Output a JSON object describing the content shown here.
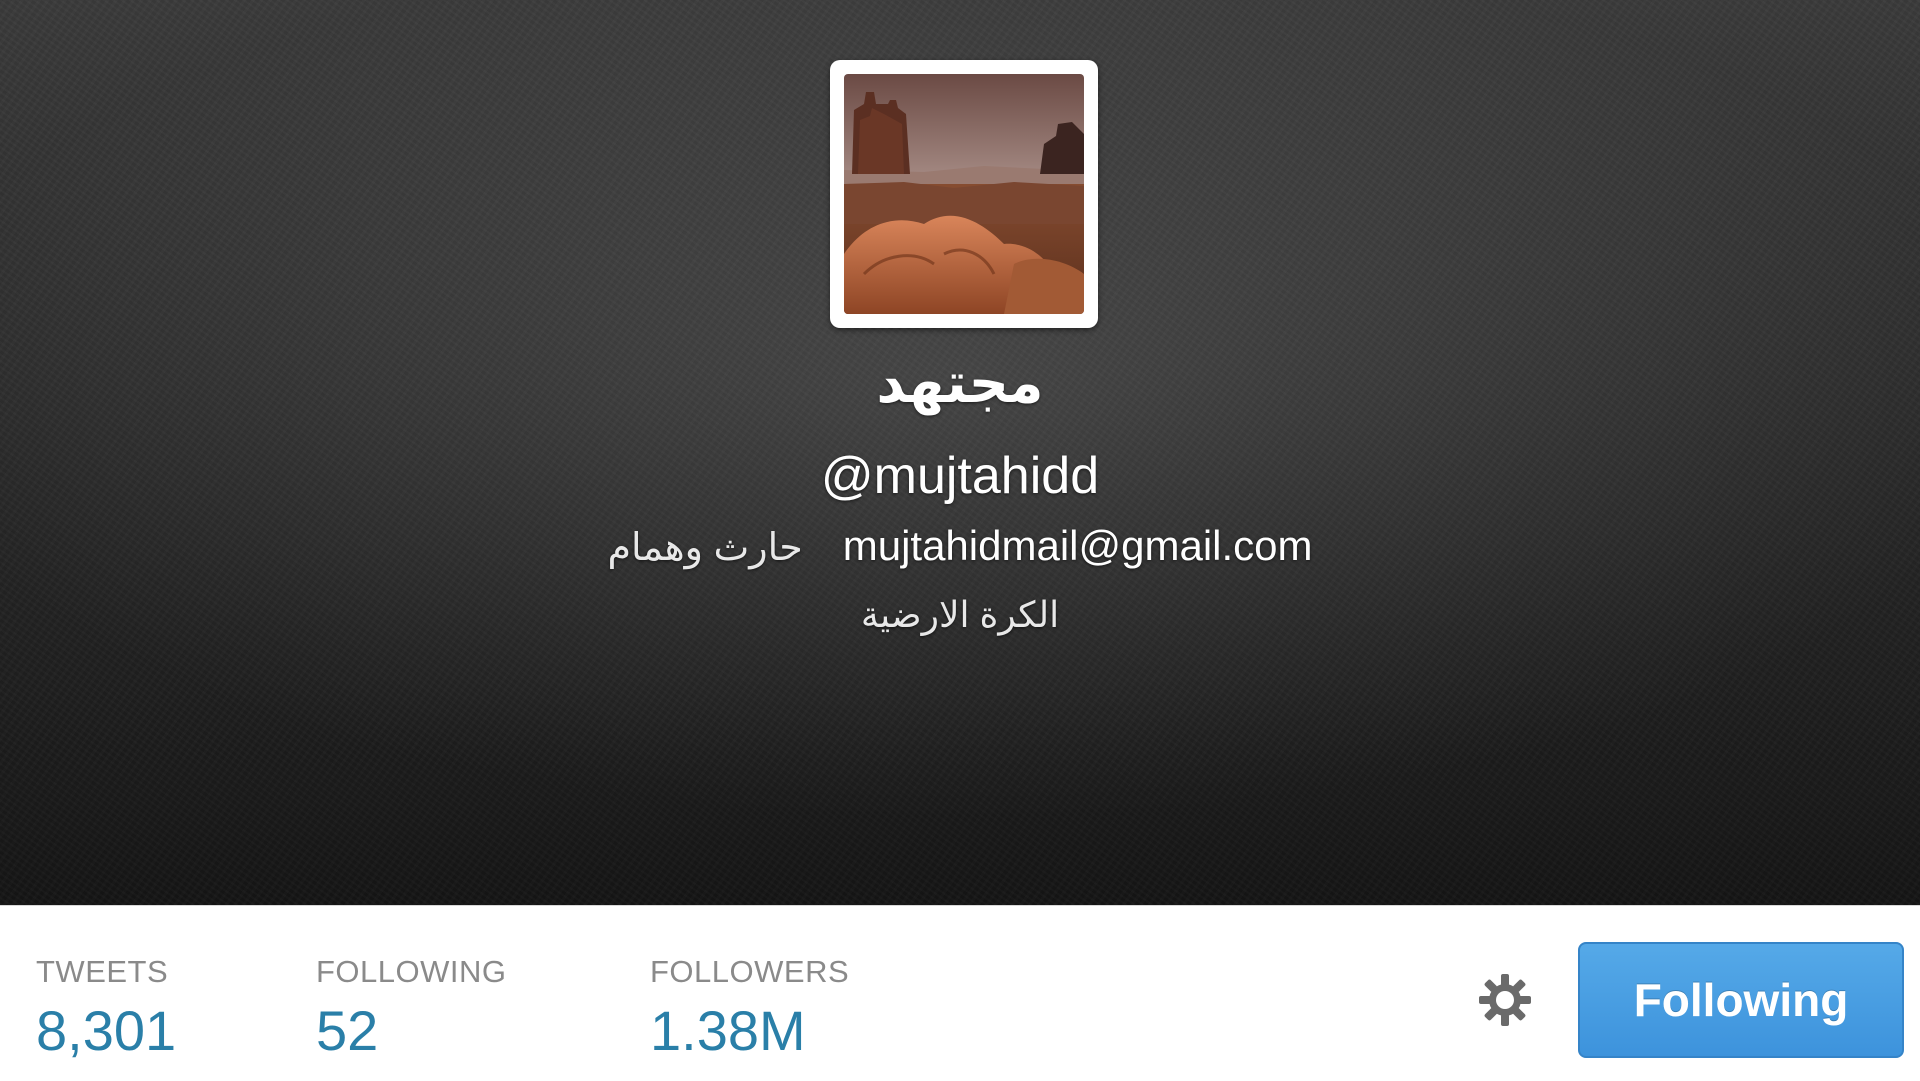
{
  "profile": {
    "name": "مجتهد",
    "screen_name": "@mujtahidd",
    "bio": "حارث وهمام",
    "email": "mujtahidmail@gmail.com",
    "location": "الكرة الارضية",
    "avatar": "desert-mesa-landscape-photo"
  },
  "stats": {
    "tweets": {
      "label": "TWEETS",
      "value": "8,301"
    },
    "following": {
      "label": "FOLLOWING",
      "value": "52"
    },
    "followers": {
      "label": "FOLLOWERS",
      "value": "1.38M"
    }
  },
  "actions": {
    "settings_icon": "gear-icon",
    "follow_button_label": "Following"
  },
  "colors": {
    "header_background": "#2c2c2c",
    "stat_value": "#2a7fa8",
    "stat_label": "#8a8a8a",
    "follow_button": "#4a9fe2"
  }
}
